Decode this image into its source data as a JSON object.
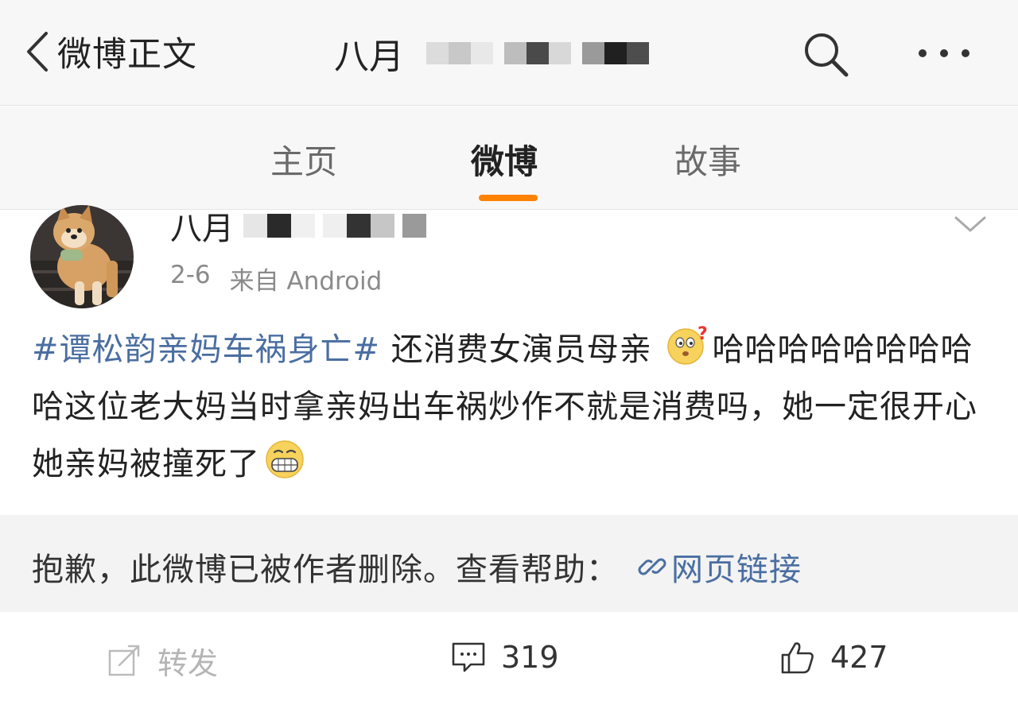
{
  "navbar": {
    "back_label": "微博正文",
    "title_prefix": "八月",
    "title_mosaic_colors": [
      "#dcdcdc",
      "#c8c8c8",
      "#e8e8e8",
      "#bdbdbd",
      "#4a4a4a",
      "#d8d8d8",
      "#9a9a9a",
      "#202020",
      "#4d4d4d"
    ],
    "search_icon": "search-icon",
    "more_icon": "more-icon"
  },
  "tabs": [
    {
      "label": "主页",
      "active": false
    },
    {
      "label": "微博",
      "active": true
    },
    {
      "label": "故事",
      "active": false
    }
  ],
  "accent_color": "#ff8200",
  "link_color": "#4a6ea1",
  "post": {
    "author_prefix": "八月",
    "author_mosaic_colors": [
      "#e6e6e6",
      "#2a2a2a",
      "#f0f0f0",
      "#efefef",
      "#333333",
      "#c6c6c6",
      "#9a9a9a"
    ],
    "date": "2-6",
    "source": "来自 Android",
    "hashtag": "#谭松韵亲妈车祸身亡#",
    "text_part1": " 还消费女演员母亲 ",
    "text_part2": "哈哈哈哈哈哈哈哈哈这位老大妈当时拿亲妈出车祸炒作不就是消费吗，她一定很开心她亲妈被撞死了",
    "emoji1": "thinking-face-emoji",
    "emoji2": "grinning-face-emoji"
  },
  "notice": {
    "text": "抱歉，此微博已被作者删除。查看帮助：",
    "link_label": "网页链接"
  },
  "actions": {
    "repost_label": "转发",
    "comment_count": "319",
    "like_count": "427"
  }
}
